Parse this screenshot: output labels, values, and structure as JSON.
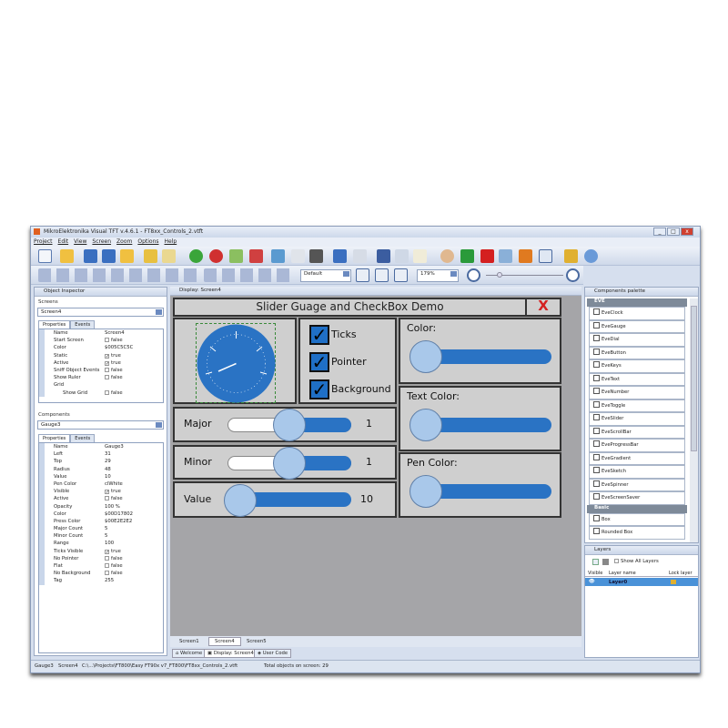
{
  "window": {
    "title": "MikroElektronika Visual TFT v.4.6.1 - FT8xx_Controls_2.vtft",
    "controls": [
      "_",
      "□",
      "x"
    ]
  },
  "menu": [
    "Project",
    "Edit",
    "View",
    "Screen",
    "Zoom",
    "Options",
    "Help"
  ],
  "toolbar2": {
    "scheme": "Default",
    "zoom": "179%"
  },
  "inspector": {
    "title": "Object Inspector",
    "screens_label": "Screens",
    "screen": "Screen4",
    "tabs": [
      "Properties",
      "Events"
    ],
    "screen_props": [
      [
        "Name",
        "Screen4",
        ""
      ],
      [
        "Start Screen",
        "false",
        "off"
      ],
      [
        "Color",
        "$005C5C5C",
        ""
      ],
      [
        "Static",
        "true",
        "on"
      ],
      [
        "Active",
        "true",
        "on"
      ],
      [
        "Sniff Object Events",
        "false",
        "off"
      ],
      [
        "Show Ruler",
        "false",
        "off"
      ],
      [
        "Grid",
        "",
        ""
      ],
      [
        "Show Grid",
        "false",
        "off"
      ]
    ],
    "components_label": "Components",
    "component": "Gauge3",
    "comp_props": [
      [
        "Name",
        "Gauge3",
        ""
      ],
      [
        "Left",
        "31",
        ""
      ],
      [
        "Top",
        "29",
        ""
      ],
      [
        "Radius",
        "48",
        ""
      ],
      [
        "Value",
        "10",
        ""
      ],
      [
        "Pen Color",
        "clWhite",
        ""
      ],
      [
        "Visible",
        "true",
        "on"
      ],
      [
        "Active",
        "false",
        "off"
      ],
      [
        "Opacity",
        "100 %",
        ""
      ],
      [
        "Color",
        "$00D17802",
        ""
      ],
      [
        "Press Color",
        "$00E2E2E2",
        ""
      ],
      [
        "Major Count",
        "5",
        ""
      ],
      [
        "Minor Count",
        "5",
        ""
      ],
      [
        "Range",
        "100",
        ""
      ],
      [
        "Ticks Visible",
        "true",
        "on"
      ],
      [
        "No Pointer",
        "false",
        "off"
      ],
      [
        "Flat",
        "false",
        "off"
      ],
      [
        "No Background",
        "false",
        "off"
      ],
      [
        "Tag",
        "255",
        ""
      ]
    ]
  },
  "display": {
    "title": "Display: Screen4",
    "screen_title": "Slider Guage and CheckBox Demo",
    "close": "X",
    "checkboxes": [
      "Ticks",
      "Pointer",
      "Background"
    ],
    "sliders": [
      {
        "label": "Major",
        "value": "1"
      },
      {
        "label": "Minor",
        "value": "1"
      },
      {
        "label": "Value",
        "value": "10"
      }
    ],
    "color_sliders": [
      "Color:",
      "Text Color:",
      "Pen Color:"
    ],
    "screen_tabs": [
      "Screen1",
      "Screen4",
      "Screen5"
    ],
    "active_screen_tab": "Screen4",
    "doc_tabs": [
      "Welcome",
      "Display: Screen4",
      "User Code"
    ]
  },
  "palette": {
    "title": "Components palette",
    "eve_label": "EVE",
    "eve_items": [
      "EveClock",
      "EveGauge",
      "EveDial",
      "EveButton",
      "EveKeys",
      "EveText",
      "EveNumber",
      "EveToggle",
      "EveSlider",
      "EveScrollBar",
      "EveProgressBar",
      "EveGradient",
      "EveSketch",
      "EveSpinner",
      "EveScreenSaver"
    ],
    "basic_label": "Basic",
    "basic_items": [
      "Box",
      "Rounded Box"
    ]
  },
  "layers": {
    "title": "Layers",
    "show_all": "Show All Layers",
    "columns": [
      "Visible",
      "Layer name",
      "Lock layer"
    ],
    "rows": [
      {
        "name": "Layer0"
      }
    ]
  },
  "status": {
    "component": "Gauge3",
    "screen": "Screen4",
    "path": "C:\\...\\Projects\\FT800\\Easy FT90x v7_FT800\\FT8xx_Controls_2.vtft",
    "objects": "Total objects on screen: 29"
  },
  "colors": {
    "accent": "#2a73c4",
    "knob": "#a9c8ea",
    "close": "#d42020"
  }
}
